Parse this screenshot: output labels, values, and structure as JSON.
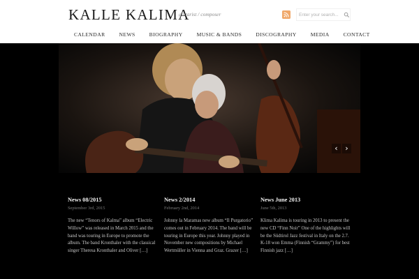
{
  "header": {
    "title": "KALLE KALIMA",
    "tagline": "guitarist / composer",
    "search": {
      "placeholder": "Enter your search..."
    }
  },
  "nav": [
    {
      "label": "CALENDAR"
    },
    {
      "label": "NEWS"
    },
    {
      "label": "BIOGRAPHY"
    },
    {
      "label": "MUSIC & BANDS"
    },
    {
      "label": "DISCOGRAPHY"
    },
    {
      "label": "MEDIA"
    },
    {
      "label": "CONTACT"
    }
  ],
  "slider": {
    "prev": "‹",
    "next": "›"
  },
  "news": [
    {
      "title": "News 08/2015",
      "date": "September 3rd, 2015",
      "text": "The new “Tenors of Kalma” album “Electric Willow” was released in March 2015 and the band was touring in Europe to promote the album. The band Kronthaler with the classical singer Theresa Kronthaler and Oliver […]"
    },
    {
      "title": "News 2/2014",
      "date": "February 2nd, 2014",
      "text": "Johnny la Maramas new album “Il Purgatorio” comes out in February 2014. The band will be touring in Europe this year. Johnny played in November new compositions by Michael Wertmüller in Vienna and Graz. Grazer […]"
    },
    {
      "title": "News June 2013",
      "date": "June 5th, 2013",
      "text": "Klima Kalima is touring in 2013 to present the new CD “Finn Noir” One of the highlights will be the Südtirol Jazz festival in Italy on the 2.7. K-18 won Emma (Finnish “Grammy”) for best Finnish jazz […]"
    }
  ],
  "colors": {
    "rss": "#f0a86a",
    "background": "#000000"
  }
}
